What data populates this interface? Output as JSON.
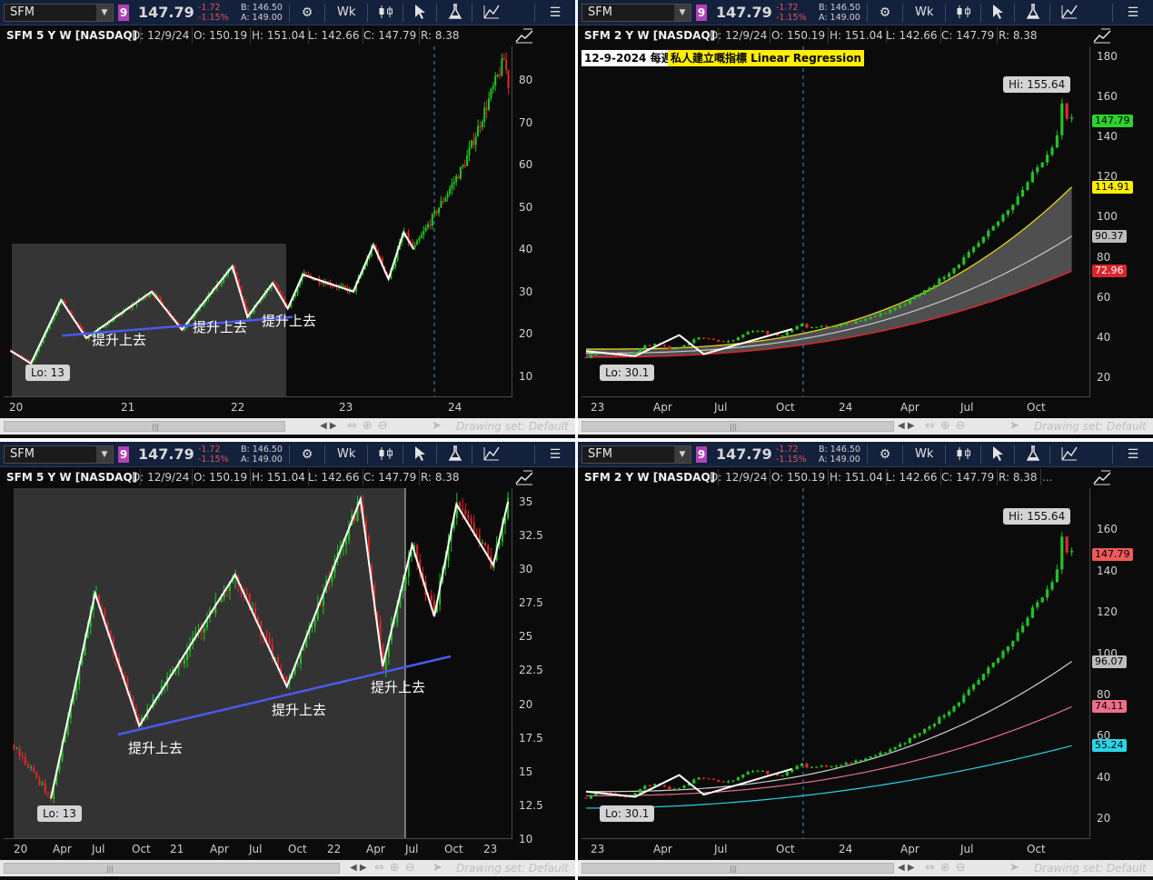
{
  "toolbar": {
    "symbol": "SFM",
    "link_group": "9",
    "last": "147.79",
    "change": "-1.72",
    "change_pct": "-1.15%",
    "bid": "B: 146.50",
    "ask": "A: 149.00",
    "aggregation": "Wk"
  },
  "icons": {
    "settings": "gear-icon",
    "style": "candlestick-style-icon",
    "cursor": "cursor-arrow-icon",
    "studies": "flask-icon",
    "drawings": "drawing-tools-icon",
    "menu": "menu-icon",
    "toggle": "chart-toggle-icon"
  },
  "panels": {
    "tl": {
      "title": "SFM 5 Y W [NASDAQ]",
      "date": "D: 12/9/24",
      "open": "O: 150.19",
      "high": "H: 151.04",
      "low": "L: 142.66",
      "close": "C: 147.79",
      "range": "R: 8.38",
      "lo_tag": "Lo: 13",
      "annotations": [
        "提升上去",
        "提升上去",
        "提升上去"
      ],
      "y_ticks": [
        "80",
        "70",
        "60",
        "50",
        "40",
        "30",
        "20",
        "10"
      ],
      "x_ticks": [
        "20",
        "21",
        "22",
        "23",
        "24"
      ],
      "drawing_set": "Drawing set: Default"
    },
    "tr": {
      "title": "SFM 2 Y W [NASDAQ]",
      "date": "D: 12/9/24",
      "open": "O: 150.19",
      "high": "H: 151.04",
      "low": "L: 142.66",
      "close": "C: 147.79",
      "range": "R: 8.38",
      "note_date": "12-9-2024 每週",
      "note_indicator": "私人建立嘅指標 Linear Regression",
      "hi_tag": "Hi: 155.64",
      "lo_tag": "Lo: 30.1",
      "y_ticks": [
        "180",
        "160",
        "140",
        "120",
        "100",
        "80",
        "60",
        "40",
        "20"
      ],
      "price_tags": [
        {
          "value": "147.79",
          "color": "#2ed12e"
        },
        {
          "value": "114.91",
          "color": "#ffee00"
        },
        {
          "value": "90.37",
          "color": "#bdbdbd"
        },
        {
          "value": "72.96",
          "color": "#d9262b"
        }
      ],
      "x_ticks": [
        "23",
        "Apr",
        "Jul",
        "Oct",
        "24",
        "Apr",
        "Jul",
        "Oct"
      ],
      "drawing_set": "Drawing set: Default"
    },
    "bl": {
      "title": "SFM 5 Y W [NASDAQ]",
      "date": "D: 12/9/24",
      "open": "O: 150.19",
      "high": "H: 151.04",
      "low": "L: 142.66",
      "close": "C: 147.79",
      "range": "R: 8.38",
      "lo_tag": "Lo: 13",
      "annotations": [
        "提升上去",
        "提升上去",
        "提升上去"
      ],
      "y_ticks": [
        "35",
        "32.5",
        "30",
        "27.5",
        "25",
        "22.5",
        "20",
        "17.5",
        "15",
        "12.5",
        "10"
      ],
      "x_ticks": [
        "20",
        "Apr",
        "Jul",
        "Oct",
        "21",
        "Apr",
        "Jul",
        "Oct",
        "22",
        "Apr",
        "Jul",
        "Oct",
        "23"
      ],
      "drawing_set": "Drawing set: Default"
    },
    "br": {
      "title": "SFM 2 Y W [NASDAQ]",
      "date": "D: 12/9/24",
      "open": "O: 150.19",
      "high": "H: 151.04",
      "low": "L: 142.66",
      "close": "C: 147.79",
      "range": "R: 8.38",
      "more": "...",
      "hi_tag": "Hi: 155.64",
      "lo_tag": "Lo: 30.1",
      "y_ticks": [
        "160",
        "140",
        "120",
        "100",
        "80",
        "60",
        "40",
        "20"
      ],
      "price_tags": [
        {
          "value": "147.79",
          "color": "#f05a5a"
        },
        {
          "value": "96.07",
          "color": "#bdbdbd"
        },
        {
          "value": "74.11",
          "color": "#ef6f8a"
        },
        {
          "value": "55.24",
          "color": "#29d6e6"
        }
      ],
      "x_ticks": [
        "23",
        "Apr",
        "Jul",
        "Oct",
        "24",
        "Apr",
        "Jul",
        "Oct"
      ],
      "drawing_set": "Drawing set: Default"
    }
  },
  "chart_data": [
    {
      "type": "candlestick",
      "title": "SFM 5 Y W [NASDAQ]",
      "x": [
        "2020",
        "2021",
        "2022",
        "2023",
        "2024"
      ],
      "close_path": [
        [
          2020.0,
          16
        ],
        [
          2020.2,
          13
        ],
        [
          2020.5,
          28
        ],
        [
          2020.75,
          19
        ],
        [
          2021.4,
          30
        ],
        [
          2021.7,
          21
        ],
        [
          2022.2,
          36
        ],
        [
          2022.35,
          24
        ],
        [
          2022.6,
          32
        ],
        [
          2022.75,
          26
        ],
        [
          2022.9,
          34
        ],
        [
          2023.4,
          30
        ],
        [
          2023.6,
          41
        ],
        [
          2023.75,
          33
        ],
        [
          2023.9,
          44
        ],
        [
          2024.0,
          40
        ],
        [
          2024.5,
          60
        ],
        [
          2024.9,
          85
        ],
        [
          2024.94,
          79
        ]
      ],
      "support_line": [
        [
          2020.6,
          20
        ],
        [
          2022.8,
          24
        ]
      ],
      "lo": 13,
      "ylim": [
        5,
        88
      ]
    },
    {
      "type": "candlestick",
      "title": "SFM 2 Y W [NASDAQ]",
      "hi": 155.64,
      "lo": 30.1,
      "last": 147.79,
      "regression_upper": 114.91,
      "regression_mid": 90.37,
      "regression_lower": 72.96,
      "ylim": [
        10,
        185
      ]
    },
    {
      "type": "candlestick",
      "title": "SFM 5 Y W [NASDAQ] (zoom)",
      "swing_path": [
        [
          2020.0,
          17
        ],
        [
          2020.25,
          13
        ],
        [
          2020.55,
          28.2
        ],
        [
          2020.85,
          18.4
        ],
        [
          2021.5,
          29.6
        ],
        [
          2021.85,
          21.3
        ],
        [
          2022.35,
          35.2
        ],
        [
          2022.5,
          22.8
        ],
        [
          2022.7,
          31.8
        ],
        [
          2022.85,
          26.5
        ],
        [
          2023.0,
          34.8
        ],
        [
          2023.25,
          30.3
        ],
        [
          2023.35,
          35
        ]
      ],
      "support_line": [
        [
          2020.8,
          18.4
        ],
        [
          2022.55,
          23.7
        ]
      ],
      "lo": 13,
      "ylim": [
        10,
        36
      ]
    },
    {
      "type": "candlestick",
      "title": "SFM 2 Y W [NASDAQ]",
      "hi": 155.64,
      "lo": 30.1,
      "last": 147.79,
      "ma_values": [
        96.07,
        74.11,
        55.24
      ],
      "ylim": [
        10,
        180
      ]
    }
  ]
}
